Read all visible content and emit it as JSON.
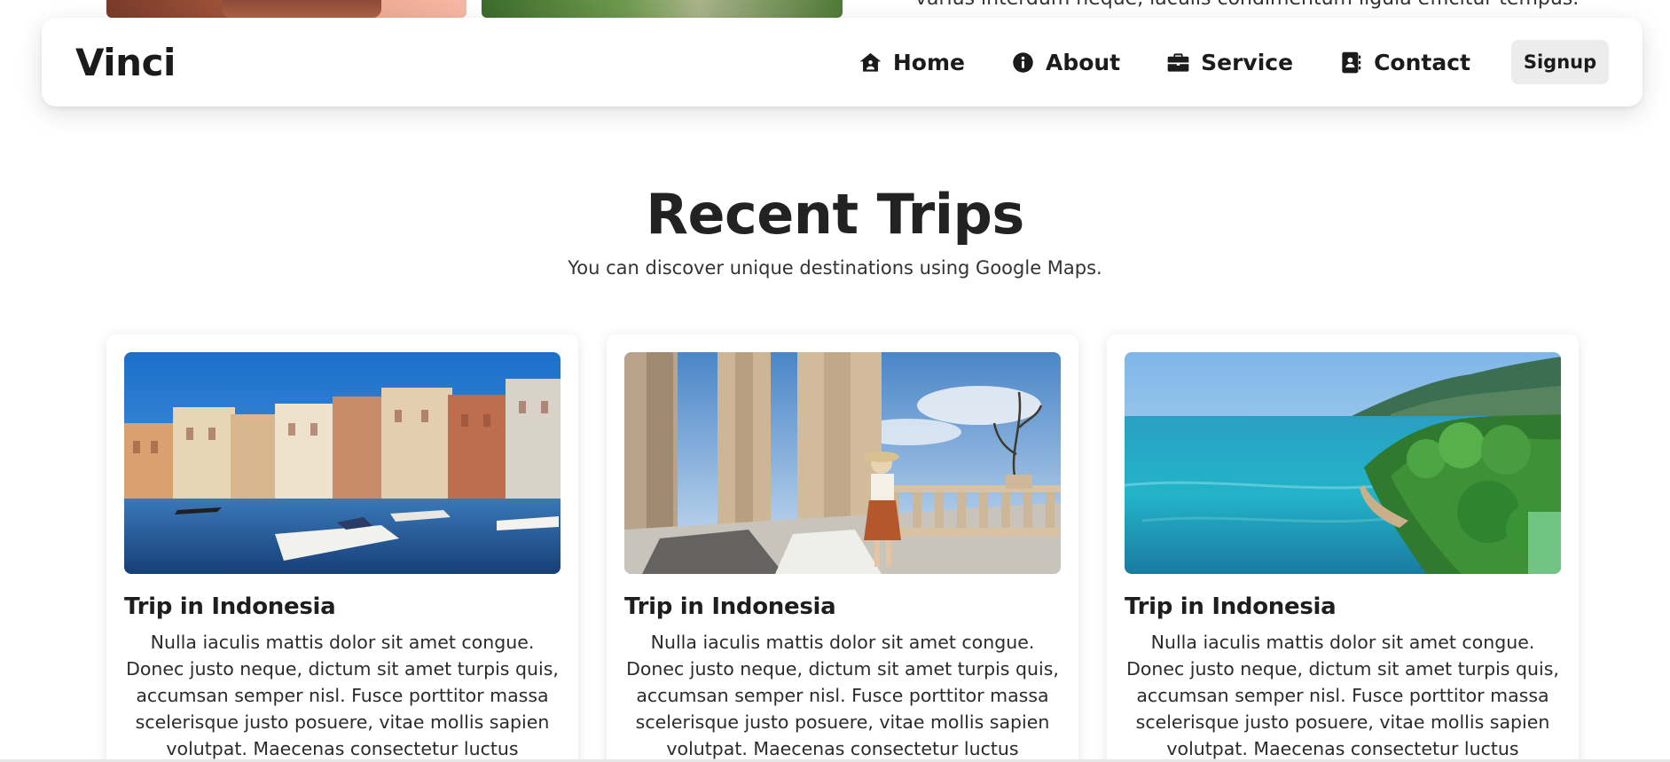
{
  "previous_section": {
    "text_fragment": "varius interdum neque, iaculis condimentum ligula efficitur tempus."
  },
  "navbar": {
    "brand": "Vinci",
    "items": [
      {
        "label": "Home",
        "icon": "home-icon"
      },
      {
        "label": "About",
        "icon": "info-icon"
      },
      {
        "label": "Service",
        "icon": "briefcase-icon"
      },
      {
        "label": "Contact",
        "icon": "address-book-icon"
      }
    ],
    "signup_label": "Signup"
  },
  "section": {
    "title": "Recent Trips",
    "subtitle": "You can discover unique destinations using Google Maps."
  },
  "cards": [
    {
      "title": "Trip in Indonesia",
      "text": "Nulla iaculis mattis dolor sit amet congue. Donec justo neque, dictum sit amet turpis quis, accumsan semper nisl. Fusce porttitor massa scelerisque justo posuere, vitae mollis sapien volutpat. Maecenas consectetur luctus posuere."
    },
    {
      "title": "Trip in Indonesia",
      "text": "Nulla iaculis mattis dolor sit amet congue. Donec justo neque, dictum sit amet turpis quis, accumsan semper nisl. Fusce porttitor massa scelerisque justo posuere, vitae mollis sapien volutpat. Maecenas consectetur luctus posuere."
    },
    {
      "title": "Trip in Indonesia",
      "text": "Nulla iaculis mattis dolor sit amet congue. Donec justo neque, dictum sit amet turpis quis, accumsan semper nisl. Fusce porttitor massa scelerisque justo posuere, vitae mollis sapien volutpat. Maecenas consectetur luctus posuere."
    }
  ],
  "colors": {
    "text_dark": "#1b1b1b",
    "signup_bg": "#ececec",
    "card_bg": "#ffffff"
  }
}
